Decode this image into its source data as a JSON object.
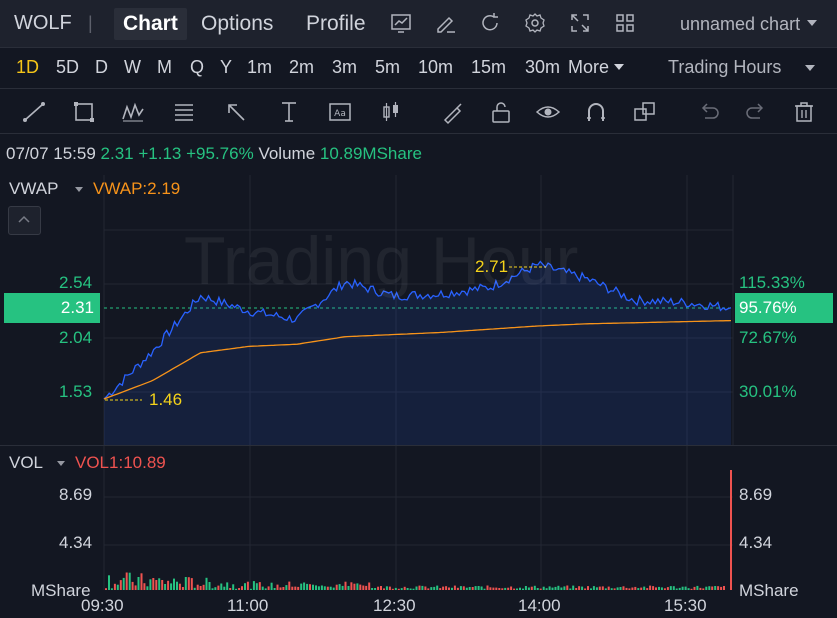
{
  "header": {
    "symbol": "WOLF",
    "tabs": [
      "Chart",
      "Options",
      "Profile"
    ],
    "active_tab": "Chart",
    "layout_name": "unnamed chart"
  },
  "intervals": {
    "items": [
      "1D",
      "5D",
      "D",
      "W",
      "M",
      "Q",
      "Y",
      "1m",
      "2m",
      "3m",
      "5m",
      "10m",
      "15m",
      "30m",
      "More"
    ],
    "active": "1D",
    "session": "Trading Hours"
  },
  "quote": {
    "datetime": "07/07 15:59",
    "price": "2.31",
    "change": "+1.13",
    "change_pct": "+95.76%",
    "volume_label": "Volume",
    "volume": "10.89MShare"
  },
  "indicators": {
    "main_name": "VWAP",
    "main_value": "VWAP:2.19",
    "sub_name": "VOL",
    "sub_value": "VOL1:10.89"
  },
  "price_axis": {
    "left": [
      "2.54",
      "2.04",
      "1.53"
    ],
    "right_pct": [
      "115.33%",
      "72.67%",
      "30.01%"
    ],
    "current_price": "2.31",
    "current_pct": "95.76%"
  },
  "annotations": {
    "high": "2.71",
    "low": "1.46"
  },
  "watermark": "Trading Hour",
  "volume_axis": {
    "left": [
      "8.69",
      "4.34",
      "MShare"
    ],
    "right": [
      "8.69",
      "4.34",
      "MShare"
    ]
  },
  "time_axis": [
    "09:30",
    "11:00",
    "12:30",
    "14:00",
    "15:30"
  ],
  "colors": {
    "up": "#26c281",
    "down": "#ef5350",
    "price_line": "#2962ff",
    "vwap_line": "#f7931a",
    "accent": "#f5c518"
  },
  "chart_data": {
    "type": "line",
    "xlabel": "",
    "ylabel": "",
    "x": [
      "09:30",
      "10:00",
      "10:30",
      "11:00",
      "11:30",
      "12:00",
      "12:30",
      "13:00",
      "13:30",
      "14:00",
      "14:30",
      "15:00",
      "15:30",
      "16:00"
    ],
    "series": [
      {
        "name": "",
        "role": "price",
        "values": [
          1.46,
          1.9,
          2.42,
          2.28,
          2.2,
          2.55,
          2.42,
          2.44,
          2.5,
          2.71,
          2.58,
          2.38,
          2.36,
          2.31
        ]
      },
      {
        "name": "VWAP",
        "values": [
          1.46,
          1.63,
          1.89,
          1.95,
          1.97,
          2.04,
          2.06,
          2.08,
          2.11,
          2.14,
          2.16,
          2.17,
          2.18,
          2.19
        ]
      }
    ],
    "volume_unit": "MShare",
    "volume_ylim": [
      0,
      13.0
    ],
    "last_volume": 10.89,
    "ylim": [
      1.4,
      2.9
    ],
    "grid": true,
    "legend": "none"
  }
}
